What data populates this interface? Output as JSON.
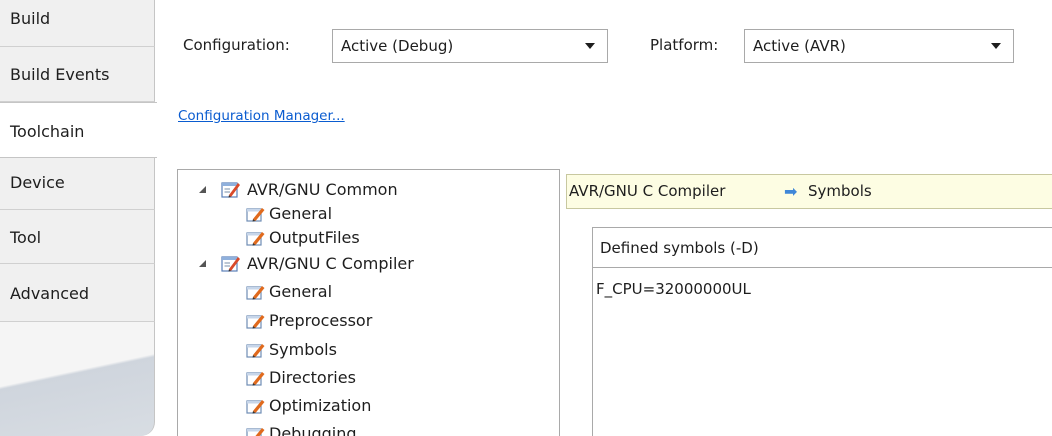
{
  "tabs": [
    {
      "label": "Build",
      "active": false
    },
    {
      "label": "Build Events",
      "active": false
    },
    {
      "label": "Toolchain",
      "active": true
    },
    {
      "label": "Device",
      "active": false
    },
    {
      "label": "Tool",
      "active": false
    },
    {
      "label": "Advanced",
      "active": false
    }
  ],
  "config": {
    "configuration_label": "Configuration:",
    "configuration_value": "Active (Debug)",
    "platform_label": "Platform:",
    "platform_value": "Active (AVR)",
    "manager_link": "Configuration Manager..."
  },
  "tree": {
    "nodes": [
      {
        "label": "AVR/GNU Common",
        "level": 0,
        "expanded": true
      },
      {
        "label": "General",
        "level": 1
      },
      {
        "label": "OutputFiles",
        "level": 1
      },
      {
        "label": "AVR/GNU C Compiler",
        "level": 0,
        "expanded": true
      },
      {
        "label": "General",
        "level": 1
      },
      {
        "label": "Preprocessor",
        "level": 1
      },
      {
        "label": "Symbols",
        "level": 1
      },
      {
        "label": "Directories",
        "level": 1
      },
      {
        "label": "Optimization",
        "level": 1
      },
      {
        "label": "Debugging",
        "level": 1
      }
    ]
  },
  "breadcrumb": {
    "parent": "AVR/GNU C Compiler",
    "arrow": "➡",
    "current": "Symbols"
  },
  "symbols": {
    "header": "Defined symbols (-D)",
    "values": [
      "F_CPU=32000000UL"
    ]
  },
  "colors": {
    "link": "#0a5cd0",
    "breadcrumb_bg": "#fdfde3",
    "breadcrumb_arrow": "#3f87d8",
    "tab_bg": "#f0f0f0"
  }
}
